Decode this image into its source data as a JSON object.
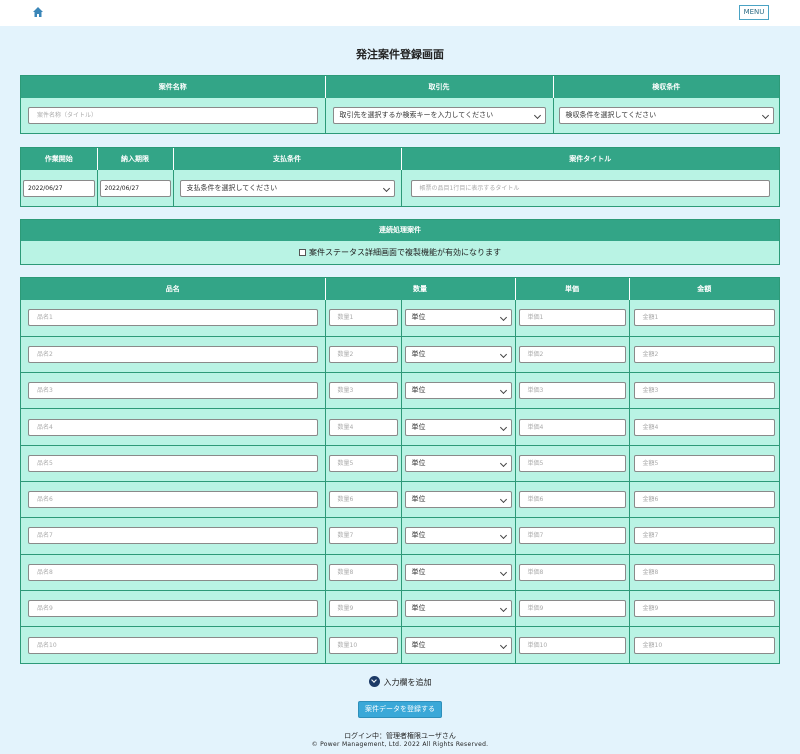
{
  "header": {
    "menu_label": "MENU"
  },
  "page_title": "発注案件登録画面",
  "section1": {
    "col_name": "案件名称",
    "col_client": "取引先",
    "col_inspection": "検収条件",
    "name_placeholder": "案件名称（タイトル）",
    "client_select": "取引先を選択するか検索キーを入力してください",
    "inspection_select": "検収条件を選択してください"
  },
  "section2": {
    "col_start": "作業開始",
    "col_due": "納入期限",
    "col_payment": "支払条件",
    "col_title": "案件タイトル",
    "start_value": "2022/06/27",
    "due_value": "2022/06/27",
    "payment_select": "支払条件を選択してください",
    "title_placeholder": "帳票の品目1行目に表示するタイトル"
  },
  "chain": {
    "header": "連続処理案件",
    "checkbox_label": "案件ステータス詳細画面で複製機能が有効になります"
  },
  "items": {
    "col_name": "品名",
    "col_qty": "数量",
    "col_price": "単価",
    "col_amount": "金額",
    "rows": [
      {
        "name": "品名1",
        "qty": "数量1",
        "unit": "単位",
        "price": "単価1",
        "amount": "金額1"
      },
      {
        "name": "品名2",
        "qty": "数量2",
        "unit": "単位",
        "price": "単価2",
        "amount": "金額2"
      },
      {
        "name": "品名3",
        "qty": "数量3",
        "unit": "単位",
        "price": "単価3",
        "amount": "金額3"
      },
      {
        "name": "品名4",
        "qty": "数量4",
        "unit": "単位",
        "price": "単価4",
        "amount": "金額4"
      },
      {
        "name": "品名5",
        "qty": "数量5",
        "unit": "単位",
        "price": "単価5",
        "amount": "金額5"
      },
      {
        "name": "品名6",
        "qty": "数量6",
        "unit": "単位",
        "price": "単価6",
        "amount": "金額6"
      },
      {
        "name": "品名7",
        "qty": "数量7",
        "unit": "単位",
        "price": "単価7",
        "amount": "金額7"
      },
      {
        "name": "品名8",
        "qty": "数量8",
        "unit": "単位",
        "price": "単価8",
        "amount": "金額8"
      },
      {
        "name": "品名9",
        "qty": "数量9",
        "unit": "単位",
        "price": "単価9",
        "amount": "金額9"
      },
      {
        "name": "品名10",
        "qty": "数量10",
        "unit": "単位",
        "price": "単価10",
        "amount": "金額10"
      }
    ]
  },
  "add_row_label": "入力欄を追加",
  "submit_label": "案件データを登録する",
  "footer": {
    "login": "ログイン中：管理者権限ユーザさん",
    "copyright": "© Power Management, Ltd. 2022 All Rights Reserved."
  },
  "colors": {
    "header_green": "#33a587",
    "panel_mint": "#b9f3e4",
    "page_bg": "#e3f3fc",
    "submit_blue": "#3aa8d8"
  },
  "icons": {
    "home": "home-icon",
    "add": "chevron-down-circle-icon"
  }
}
